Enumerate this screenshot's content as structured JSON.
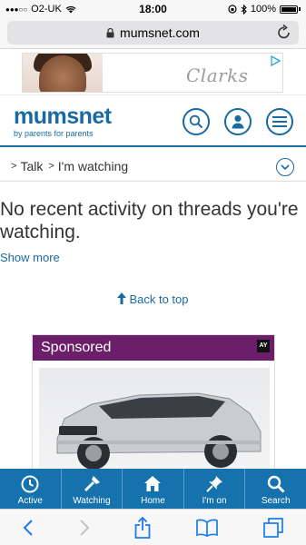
{
  "status_bar": {
    "carrier": "O2-UK",
    "time": "18:00",
    "battery": "100%"
  },
  "browser": {
    "url": "mumsnet.com"
  },
  "ad_banner": {
    "brand": "Clarks"
  },
  "site": {
    "logo_text": "mumsnet",
    "tagline": "by parents for parents"
  },
  "breadcrumb": {
    "items": [
      "Talk",
      "I'm watching"
    ]
  },
  "main": {
    "message": "No recent activity on threads you're watching.",
    "show_more": "Show more",
    "back_to_top": "Back to top"
  },
  "sponsored": {
    "label": "Sponsored",
    "badge": "AY"
  },
  "tabbar": {
    "tabs": [
      {
        "label": "Active",
        "icon": "clock-icon"
      },
      {
        "label": "Watching",
        "icon": "flashlight-icon"
      },
      {
        "label": "Home",
        "icon": "home-icon"
      },
      {
        "label": "I'm on",
        "icon": "pin-icon"
      },
      {
        "label": "Search",
        "icon": "search-icon"
      }
    ]
  },
  "colors": {
    "brand_blue": "#1a6aa2",
    "tabbar_blue": "#1572ad",
    "sponsored_purple": "#6b1f6b",
    "ios_blue": "#1a7cf0"
  }
}
